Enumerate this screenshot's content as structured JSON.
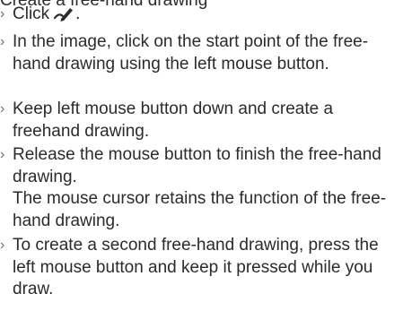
{
  "heading": {
    "partial": "Create a free-hand drawing"
  },
  "steps": [
    {
      "marker": "›",
      "before_icon": "Click",
      "icon": "freehand-pen-icon",
      "after_icon": "."
    },
    {
      "marker": "›",
      "text": "In the image, click on the start point of the free-hand drawing using the left mouse button."
    },
    {
      "marker": "›",
      "text": "Keep left mouse button down and create a freehand drawing."
    },
    {
      "marker": "›",
      "text": "Release the mouse button to finish the free-hand drawing.",
      "note": "The mouse cursor retains the function of the free-hand drawing."
    },
    {
      "marker": "›",
      "text": "To create a second free-hand drawing, press the left mouse button and keep it pressed while you draw."
    }
  ]
}
